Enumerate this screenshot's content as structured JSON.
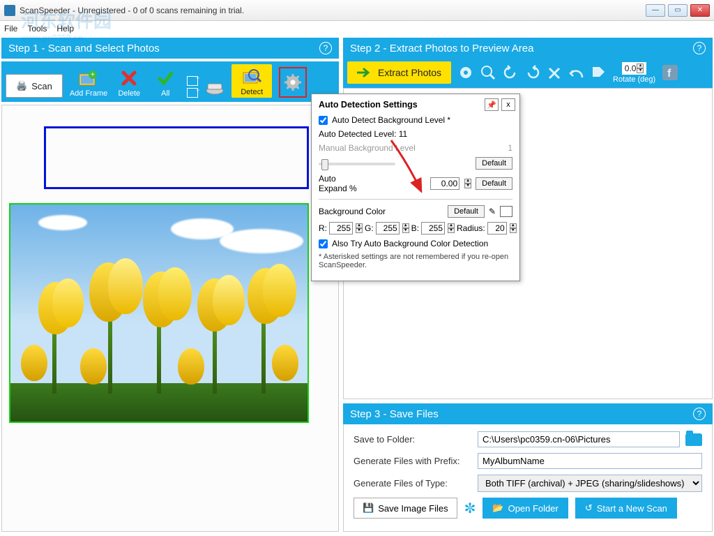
{
  "window": {
    "title": "ScanSpeeder - Unregistered - 0 of 0 scans remaining in trial."
  },
  "menu": {
    "file": "File",
    "tools": "Tools",
    "help": "Help"
  },
  "watermark": {
    "text": "河东软件园",
    "url": "www.pc0359.cn"
  },
  "step1": {
    "title": "Step 1 - Scan and Select Photos",
    "scan": "Scan",
    "addframe": "Add Frame",
    "delete": "Delete",
    "all": "All",
    "detect": "Detect"
  },
  "step2": {
    "title": "Step 2 - Extract Photos to Preview Area",
    "extract": "Extract Photos",
    "rotate_label": "Rotate (deg)",
    "rotate_value": "0.0"
  },
  "popup": {
    "title": "Auto Detection Settings",
    "autodetect": "Auto Detect Background Level *",
    "detected_level": "Auto Detected Level: 11",
    "manual_label": "Manual Background Level",
    "manual_value": "1",
    "default": "Default",
    "expand_label_a": "Auto",
    "expand_label_b": "Expand %",
    "expand_value": "0.00",
    "bgcolor": "Background Color",
    "r": "R:",
    "g": "G:",
    "b": "B:",
    "radius": "Radius:",
    "rv": "255",
    "gv": "255",
    "bv": "255",
    "radv": "20",
    "alsotry": "Also Try Auto Background Color Detection",
    "note": "* Asterisked settings are not remembered if you re-open ScanSpeeder.",
    "close": "x",
    "pin": "📌"
  },
  "step3": {
    "title": "Step 3 - Save Files",
    "save_to": "Save to Folder:",
    "path": "C:\\Users\\pc0359.cn-06\\Pictures",
    "prefix_label": "Generate Files with Prefix:",
    "prefix": "MyAlbumName",
    "type_label": "Generate Files of Type:",
    "type": "Both TIFF (archival) + JPEG (sharing/slideshows)",
    "save_images": "Save Image Files",
    "open_folder": "Open Folder",
    "new_scan": "Start a New Scan"
  }
}
